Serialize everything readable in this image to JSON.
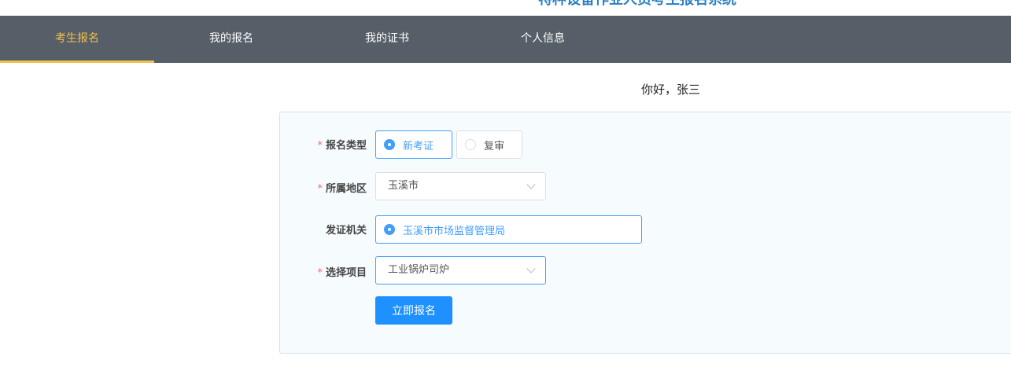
{
  "app_title": "特种设备作业人员考生报名系统",
  "nav": {
    "tabs": [
      {
        "label": "考生报名",
        "active": true
      },
      {
        "label": "我的报名",
        "active": false
      },
      {
        "label": "我的证书",
        "active": false
      },
      {
        "label": "个人信息",
        "active": false
      }
    ],
    "active_color": "#f2c14e",
    "background_color": "#565e67"
  },
  "greeting": "你好，张三",
  "form": {
    "registration_type": {
      "label": "报名类型",
      "required": true,
      "options": [
        {
          "label": "新考证",
          "checked": true
        },
        {
          "label": "复审",
          "checked": false
        }
      ]
    },
    "region": {
      "label": "所属地区",
      "required": true,
      "value": "玉溪市"
    },
    "issuing_authority": {
      "label": "发证机关",
      "required": false,
      "value": "玉溪市市场监督管理局",
      "checked": true
    },
    "project": {
      "label": "选择项目",
      "required": true,
      "value": "工业锅炉司炉"
    },
    "submit_label": "立即报名",
    "required_mark": "*"
  },
  "colors": {
    "primary": "#409eff",
    "button": "#1e90ff",
    "required": "#f56c6c"
  }
}
